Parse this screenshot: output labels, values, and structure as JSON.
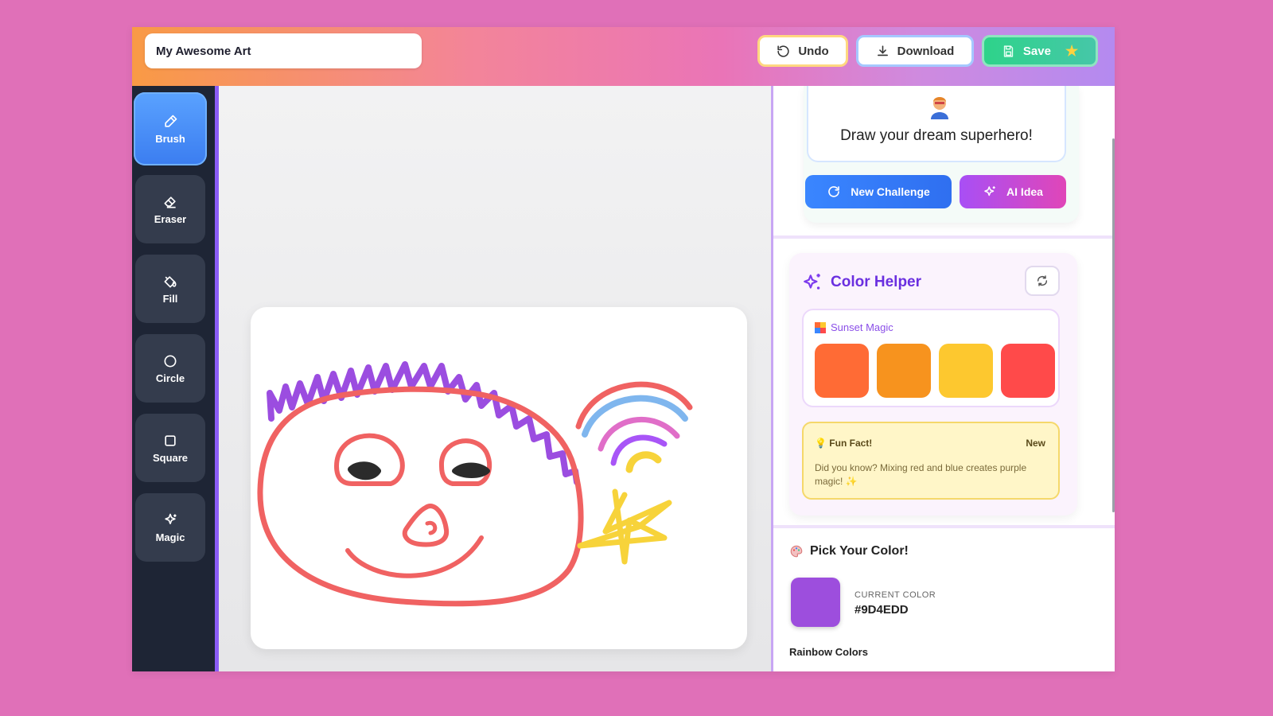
{
  "header": {
    "title_value": "My Awesome Art",
    "undo_label": "Undo",
    "download_label": "Download",
    "save_label": "Save"
  },
  "toolbar": {
    "tools": [
      {
        "label": "Brush",
        "icon": "brush-icon",
        "active": true
      },
      {
        "label": "Eraser",
        "icon": "eraser-icon",
        "active": false
      },
      {
        "label": "Fill",
        "icon": "fill-icon",
        "active": false
      },
      {
        "label": "Circle",
        "icon": "circle-icon",
        "active": false
      },
      {
        "label": "Square",
        "icon": "square-icon",
        "active": false
      },
      {
        "label": "Magic",
        "icon": "magic-icon",
        "active": false
      }
    ]
  },
  "challenge": {
    "prompt": "Draw your dream superhero!",
    "new_challenge_label": "New Challenge",
    "ai_idea_label": "AI Idea"
  },
  "color_helper": {
    "title": "Color Helper",
    "palette_name": "Sunset Magic",
    "swatches": [
      "#ff6b35",
      "#f7931e",
      "#fdc82f",
      "#ff4a4a"
    ],
    "fun_fact": {
      "title": "Fun Fact!",
      "tag": "New",
      "text": "Did you know? Mixing red and blue creates purple magic! ✨"
    }
  },
  "color_picker": {
    "title": "Pick Your Color!",
    "current_label": "CURRENT COLOR",
    "current_value": "#9D4EDD",
    "rainbow_label": "Rainbow Colors"
  },
  "colors": {
    "accent": "#8b5cf6",
    "brush_active": "#3b7df0",
    "toolbar_bg": "#1e2535"
  }
}
